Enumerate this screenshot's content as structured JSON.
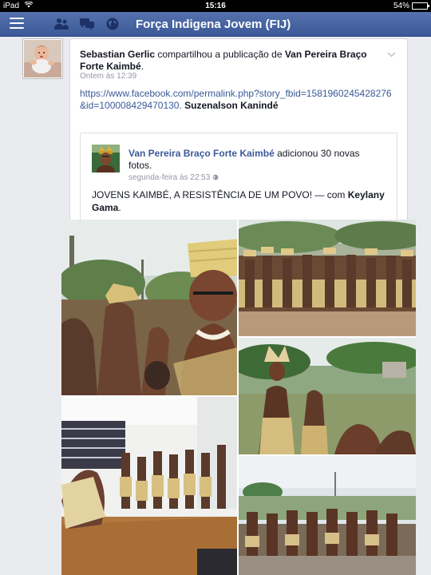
{
  "status_bar": {
    "device": "iPad",
    "time": "15:16",
    "battery": "54%",
    "battery_level": 0.54
  },
  "nav": {
    "title": "Força Indigena Jovem (FIJ)",
    "icons": [
      "menu-icon",
      "friends-icon",
      "messages-icon",
      "globe-icon"
    ]
  },
  "post": {
    "author": "Sebastian Gerlic",
    "action": "compartilhou a publicação de",
    "target": "Van Pereira Braço Forte Kaimbé",
    "timestamp": "Ontem às 12:39",
    "link": "https://www.facebook.com/permalink.php?story_fbid=1581960245428276&id=100008429470130.",
    "tagged": "Suzenalson Kanindé"
  },
  "shared_post": {
    "author": "Van Pereira Braço Forte Kaimbé",
    "action": "adicionou 30 novas fotos.",
    "timestamp": "segunda-feira às 22:53",
    "text": "JOVENS KAIMBÉ, A RESISTÊNCIA DE UM POVO! — com",
    "with": "Keylany Gama"
  },
  "colors": {
    "nav_bar": "#3b5998",
    "link": "#3b5998",
    "meta_text": "#9197a3"
  }
}
